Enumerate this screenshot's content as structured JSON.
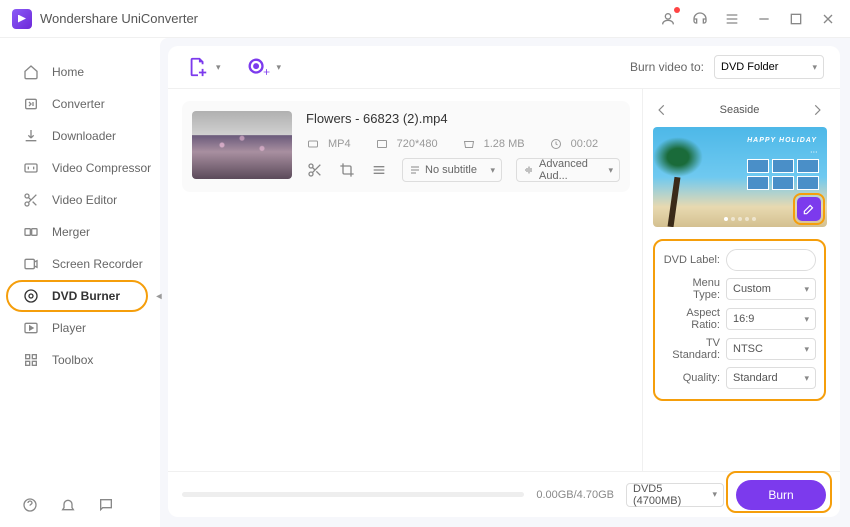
{
  "app": {
    "title": "Wondershare UniConverter"
  },
  "sidebar": {
    "items": [
      {
        "label": "Home"
      },
      {
        "label": "Converter"
      },
      {
        "label": "Downloader"
      },
      {
        "label": "Video Compressor"
      },
      {
        "label": "Video Editor"
      },
      {
        "label": "Merger"
      },
      {
        "label": "Screen Recorder"
      },
      {
        "label": "DVD Burner"
      },
      {
        "label": "Player"
      },
      {
        "label": "Toolbox"
      }
    ],
    "active_index": 7
  },
  "toolbar": {
    "burn_to_label": "Burn video to:",
    "burn_to_value": "DVD Folder"
  },
  "file": {
    "name": "Flowers - 66823 (2).mp4",
    "format": "MP4",
    "resolution": "720*480",
    "size": "1.28 MB",
    "duration": "00:02",
    "subtitle": "No subtitle",
    "audio": "Advanced Aud..."
  },
  "theme": {
    "name": "Seaside",
    "banner": "HAPPY HOLIDAY"
  },
  "settings": {
    "dvd_label": {
      "label": "DVD Label:",
      "value": ""
    },
    "menu_type": {
      "label": "Menu Type:",
      "value": "Custom"
    },
    "aspect_ratio": {
      "label": "Aspect Ratio:",
      "value": "16:9"
    },
    "tv_standard": {
      "label": "TV Standard:",
      "value": "NTSC"
    },
    "quality": {
      "label": "Quality:",
      "value": "Standard"
    }
  },
  "footer": {
    "size_text": "0.00GB/4.70GB",
    "disc_type": "DVD5 (4700MB)",
    "burn_label": "Burn"
  }
}
